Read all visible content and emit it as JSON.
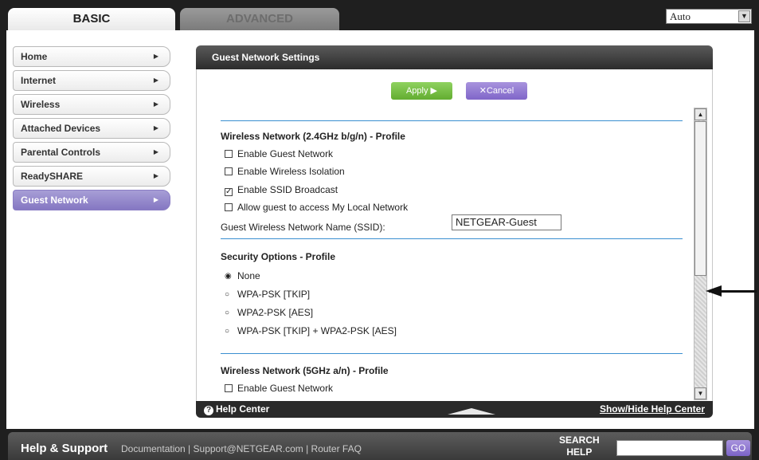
{
  "tabs": {
    "basic": "BASIC",
    "advanced": "ADVANCED"
  },
  "language": {
    "selected": "Auto"
  },
  "sidebar": {
    "items": [
      {
        "label": "Home"
      },
      {
        "label": "Internet"
      },
      {
        "label": "Wireless"
      },
      {
        "label": "Attached Devices"
      },
      {
        "label": "Parental Controls"
      },
      {
        "label": "ReadySHARE"
      },
      {
        "label": "Guest Network",
        "active": true
      }
    ]
  },
  "panel": {
    "title": "Guest Network Settings",
    "apply_label": "Apply ▶",
    "cancel_label": "✕Cancel",
    "wireless24": {
      "title": "Wireless Network (2.4GHz b/g/n) - Profile",
      "enable_guest": {
        "label": "Enable Guest Network",
        "checked": false
      },
      "wireless_isolation": {
        "label": "Enable Wireless Isolation",
        "checked": false
      },
      "ssid_broadcast": {
        "label": "Enable SSID Broadcast",
        "checked": true
      },
      "allow_local": {
        "label": "Allow guest to access My Local Network",
        "checked": false
      },
      "ssid_label": "Guest Wireless Network Name (SSID):",
      "ssid_value": "NETGEAR-Guest"
    },
    "security": {
      "title": "Security Options - Profile",
      "options": [
        {
          "label": "None",
          "selected": true
        },
        {
          "label": "WPA-PSK [TKIP]",
          "selected": false
        },
        {
          "label": "WPA2-PSK [AES]",
          "selected": false
        },
        {
          "label": "WPA-PSK [TKIP] + WPA2-PSK [AES]",
          "selected": false
        }
      ]
    },
    "wireless5": {
      "title": "Wireless Network (5GHz a/n) - Profile",
      "enable_guest": {
        "label": "Enable Guest Network",
        "checked": false
      }
    },
    "help_center": "Help Center",
    "help_toggle": "Show/Hide Help Center"
  },
  "footer": {
    "title": "Help & Support",
    "link_documentation": "Documentation",
    "link_support": "Support@NETGEAR.com",
    "link_faq": "Router FAQ",
    "search_label_1": "SEARCH",
    "search_label_2": "HELP",
    "go_label": "GO"
  },
  "colors": {
    "active_nav": "#8577c2",
    "apply": "#63ad31",
    "cancel": "#8066c9",
    "divider": "#3a8fd1"
  }
}
